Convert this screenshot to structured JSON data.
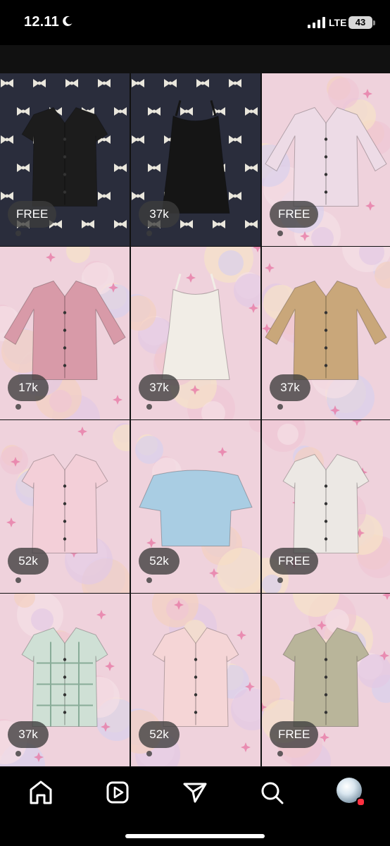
{
  "status_bar": {
    "time": "12.11",
    "network": "LTE",
    "battery": "43"
  },
  "grid": {
    "tiles": [
      {
        "price": "",
        "background": "denim",
        "garment": "shirt",
        "color": "#1e1e1e"
      },
      {
        "price": "",
        "background": "denim",
        "garment": "dress",
        "color": "#1a1a1a"
      },
      {
        "price": "",
        "background": "denim",
        "garment": "dress",
        "color": "#1a1a1a"
      },
      {
        "price": "FREE",
        "background": "denim",
        "garment": "shirt",
        "color": "#1c1c1c"
      },
      {
        "price": "37k",
        "background": "denim",
        "garment": "romper",
        "color": "#151515"
      },
      {
        "price": "FREE",
        "background": "pastel",
        "garment": "blouse",
        "color": "#eddbe6"
      },
      {
        "price": "17k",
        "background": "pastel",
        "garment": "blouse",
        "color": "#d89aa8"
      },
      {
        "price": "37k",
        "background": "pastel",
        "garment": "camisole",
        "color": "#f1ede6"
      },
      {
        "price": "37k",
        "background": "pastel",
        "garment": "jacket",
        "color": "#c9a77a"
      },
      {
        "price": "52k",
        "background": "pastel",
        "garment": "shirt",
        "color": "#f3cfd8"
      },
      {
        "price": "52k",
        "background": "pastel",
        "garment": "offshoulder",
        "color": "#a9cde3"
      },
      {
        "price": "FREE",
        "background": "pastel",
        "garment": "shirt",
        "color": "#ece8e4"
      },
      {
        "price": "37k",
        "background": "pastel",
        "garment": "plaid",
        "color": "#cfe0d5"
      },
      {
        "price": "52k",
        "background": "pastel",
        "garment": "shirt",
        "color": "#f5d5d6"
      },
      {
        "price": "FREE",
        "background": "pastel",
        "garment": "shirt",
        "color": "#b9b59a"
      }
    ]
  },
  "bottom_nav": {
    "items": [
      {
        "icon": "home-icon"
      },
      {
        "icon": "reels-icon"
      },
      {
        "icon": "send-icon"
      },
      {
        "icon": "search-icon"
      },
      {
        "icon": "profile-avatar"
      }
    ]
  },
  "colors": {
    "accent_dot": "#ff3040",
    "denim": "#2a2d3c",
    "pastel": "#efd2dc"
  }
}
